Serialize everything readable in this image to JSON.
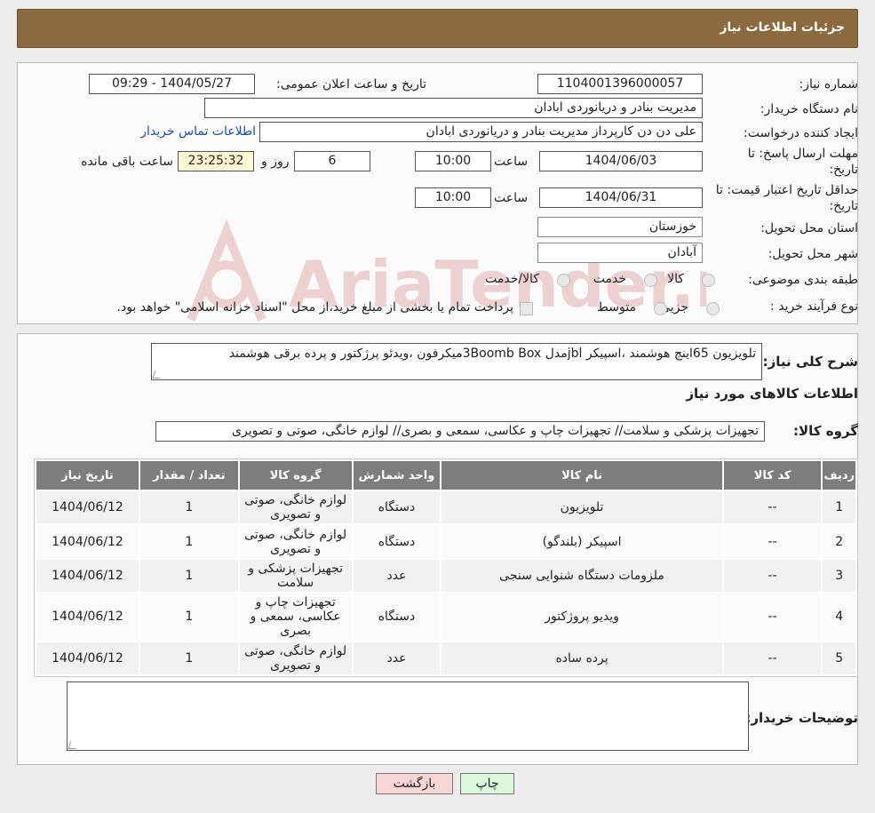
{
  "header": {
    "title": "جزئیات اطلاعات نیاز"
  },
  "form": {
    "need_number_label": "شماره نیاز:",
    "need_number": "1104001396000057",
    "announce_label": "تاریخ و ساعت اعلان عمومی:",
    "announce_value": "1404/05/27 - 09:29",
    "buyer_org_label": "نام دستگاه خریدار:",
    "buyer_org": "مدیریت بنادر و دریانوردی ابادان",
    "creator_label": "ایجاد کننده درخواست:",
    "creator": "علی دن دن کارپرداز  مدیریت بنادر و دریانوردی ابادان",
    "contact_link": "اطلاعات تماس خریدار",
    "deadline_label_1": "مهلت ارسال پاسخ: تا",
    "deadline_label_2": "تاریخ:",
    "deadline_date": "1404/06/03",
    "time_label": "ساعت",
    "deadline_time": "10:00",
    "days_value": "6",
    "days_label": "روز و",
    "remaining_time": "23:25:32",
    "remaining_label": "ساعت باقی مانده",
    "validity_label_1": "حداقل تاریخ اعتبار قیمت: تا",
    "validity_label_2": "تاریخ:",
    "validity_date": "1404/06/31",
    "validity_time": "10:00",
    "province_label": "استان محل تحویل:",
    "province": "خوزستان",
    "city_label": "شهر محل تحویل:",
    "city": "آبادان",
    "category_label": "طبقه بندی موضوعی:",
    "category_options": [
      "کالا",
      "خدمت",
      "کالا/خدمت"
    ],
    "process_label": "نوع فرآیند خرید :",
    "process_options": [
      "جزیی",
      "متوسط"
    ],
    "process_note": "پرداخت تمام یا بخشی از مبلغ خرید،از محل \"اسناد خزانه اسلامی\" خواهد بود."
  },
  "watermark": {
    "text": "AriaTender.neT"
  },
  "summary": {
    "label": "شرح کلی نیاز:",
    "text": "تلویزیون 65اینچ هوشمند ،اسپیکر jblمدل 3Boomb Boxمیکرفون ،ویدئو پرژکتور و پرده برقی هوشمند"
  },
  "goods": {
    "section_title": "اطلاعات کالاهای مورد نیاز",
    "group_label": "گروه کالا:",
    "group_value": "تجهیزات پزشکی و سلامت// تجهیزات چاپ و عکاسی، سمعی و بصری// لوازم خانگی، صوتی و تصویری"
  },
  "table": {
    "headers": [
      "ردیف",
      "کد کالا",
      "نام کالا",
      "واحد شمارش",
      "گروه کالا",
      "تعداد / مقدار",
      "تاریخ نیاز"
    ],
    "rows": [
      [
        "1",
        "--",
        "تلویزیون",
        "دستگاه",
        "لوازم خانگی، صوتی و تصویری",
        "1",
        "1404/06/12"
      ],
      [
        "2",
        "--",
        "اسپیکر (بلندگو)",
        "دستگاه",
        "لوازم خانگی، صوتی و تصویری",
        "1",
        "1404/06/12"
      ],
      [
        "3",
        "--",
        "ملزومات دستگاه شنوایی سنجی",
        "عدد",
        "تجهیزات پزشکی و سلامت",
        "1",
        "1404/06/12"
      ],
      [
        "4",
        "--",
        "ویدیو پروژکتور",
        "دستگاه",
        "تجهیزات چاپ و عکاسی، سمعی و بصری",
        "1",
        "1404/06/12"
      ],
      [
        "5",
        "--",
        "پرده ساده",
        "عدد",
        "لوازم خانگی، صوتی و تصویری",
        "1",
        "1404/06/12"
      ]
    ]
  },
  "notes": {
    "label": "توضیحات خریدار:",
    "value": ""
  },
  "buttons": {
    "print": "چاپ",
    "back": "بازگشت"
  },
  "colors": {
    "header": "#8b6a3e",
    "link": "#1a4fb4",
    "back_button": "#f9d6d6",
    "print_button": "#d9f7d9"
  }
}
